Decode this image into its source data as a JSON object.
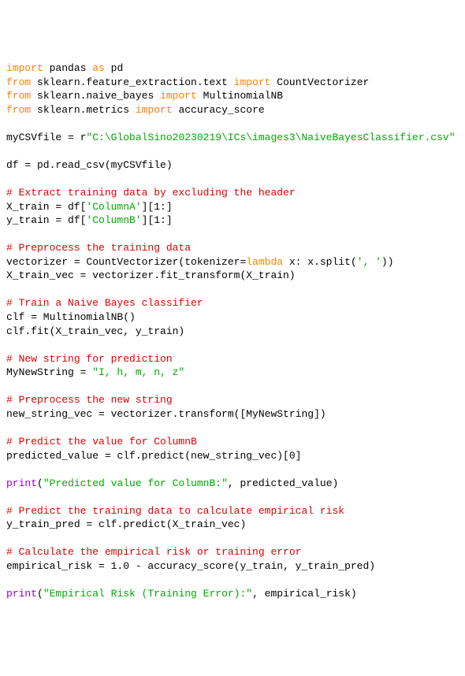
{
  "lines": [
    {
      "type": "code",
      "spans": [
        {
          "cls": "kw",
          "t": "import"
        },
        {
          "cls": "nam",
          "t": " pandas "
        },
        {
          "cls": "kw",
          "t": "as"
        },
        {
          "cls": "nam",
          "t": " pd"
        }
      ]
    },
    {
      "type": "code",
      "spans": [
        {
          "cls": "kw",
          "t": "from"
        },
        {
          "cls": "nam",
          "t": " sklearn.feature_extraction.text "
        },
        {
          "cls": "kw",
          "t": "import"
        },
        {
          "cls": "nam",
          "t": " CountVectorizer"
        }
      ]
    },
    {
      "type": "code",
      "spans": [
        {
          "cls": "kw",
          "t": "from"
        },
        {
          "cls": "nam",
          "t": " sklearn.naive_bayes "
        },
        {
          "cls": "kw",
          "t": "import"
        },
        {
          "cls": "nam",
          "t": " MultinomialNB"
        }
      ]
    },
    {
      "type": "code",
      "spans": [
        {
          "cls": "kw",
          "t": "from"
        },
        {
          "cls": "nam",
          "t": " sklearn.metrics "
        },
        {
          "cls": "kw",
          "t": "import"
        },
        {
          "cls": "nam",
          "t": " accuracy_score"
        }
      ]
    },
    {
      "type": "blank"
    },
    {
      "type": "code",
      "spans": [
        {
          "cls": "nam",
          "t": "myCSVfile = "
        },
        {
          "cls": "raw",
          "t": "r"
        },
        {
          "cls": "str",
          "t": "\"C:\\GlobalSino20230219\\ICs\\images3\\NaiveBayesClassifier.csv\""
        }
      ]
    },
    {
      "type": "blank"
    },
    {
      "type": "code",
      "spans": [
        {
          "cls": "nam",
          "t": "df = pd.read_csv(myCSVfile)"
        }
      ]
    },
    {
      "type": "blank"
    },
    {
      "type": "comment",
      "t": "# Extract training data by excluding the header"
    },
    {
      "type": "code",
      "spans": [
        {
          "cls": "nam",
          "t": "X_train = df["
        },
        {
          "cls": "str",
          "t": "'ColumnA'"
        },
        {
          "cls": "nam",
          "t": "][1:]"
        }
      ]
    },
    {
      "type": "code",
      "spans": [
        {
          "cls": "nam",
          "t": "y_train = df["
        },
        {
          "cls": "str",
          "t": "'ColumnB'"
        },
        {
          "cls": "nam",
          "t": "][1:]"
        }
      ]
    },
    {
      "type": "blank"
    },
    {
      "type": "comment",
      "t": "# Preprocess the training data"
    },
    {
      "type": "code",
      "spans": [
        {
          "cls": "nam",
          "t": "vectorizer = CountVectorizer(tokenizer="
        },
        {
          "cls": "kw",
          "t": "lambda"
        },
        {
          "cls": "nam",
          "t": " x: x.split("
        },
        {
          "cls": "str",
          "t": "', '"
        },
        {
          "cls": "nam",
          "t": "))"
        }
      ]
    },
    {
      "type": "code",
      "spans": [
        {
          "cls": "nam",
          "t": "X_train_vec = vectorizer.fit_transform(X_train)"
        }
      ]
    },
    {
      "type": "blank"
    },
    {
      "type": "comment",
      "t": "# Train a Naive Bayes classifier"
    },
    {
      "type": "code",
      "spans": [
        {
          "cls": "nam",
          "t": "clf = MultinomialNB()"
        }
      ]
    },
    {
      "type": "code",
      "spans": [
        {
          "cls": "nam",
          "t": "clf.fit(X_train_vec, y_train)"
        }
      ]
    },
    {
      "type": "blank"
    },
    {
      "type": "comment",
      "t": "# New string for prediction"
    },
    {
      "type": "code",
      "spans": [
        {
          "cls": "nam",
          "t": "MyNewString = "
        },
        {
          "cls": "str",
          "t": "\"I, h, m, n, z\""
        }
      ]
    },
    {
      "type": "blank"
    },
    {
      "type": "comment",
      "t": "# Preprocess the new string"
    },
    {
      "type": "code",
      "spans": [
        {
          "cls": "nam",
          "t": "new_string_vec = vectorizer.transform([MyNewString])"
        }
      ]
    },
    {
      "type": "blank"
    },
    {
      "type": "comment",
      "t": "# Predict the value for ColumnB"
    },
    {
      "type": "code",
      "spans": [
        {
          "cls": "nam",
          "t": "predicted_value = clf.predict(new_string_vec)[0]"
        }
      ]
    },
    {
      "type": "blank"
    },
    {
      "type": "code",
      "spans": [
        {
          "cls": "fn",
          "t": "print"
        },
        {
          "cls": "nam",
          "t": "("
        },
        {
          "cls": "str",
          "t": "\"Predicted value for ColumnB:\""
        },
        {
          "cls": "nam",
          "t": ", predicted_value)"
        }
      ]
    },
    {
      "type": "blank"
    },
    {
      "type": "comment",
      "t": "# Predict the training data to calculate empirical risk"
    },
    {
      "type": "code",
      "spans": [
        {
          "cls": "nam",
          "t": "y_train_pred = clf.predict(X_train_vec)"
        }
      ]
    },
    {
      "type": "blank"
    },
    {
      "type": "comment",
      "t": "# Calculate the empirical risk or training error"
    },
    {
      "type": "code",
      "spans": [
        {
          "cls": "nam",
          "t": "empirical_risk = 1.0 - accuracy_score(y_train, y_train_pred)"
        }
      ]
    },
    {
      "type": "blank"
    },
    {
      "type": "code",
      "spans": [
        {
          "cls": "fn",
          "t": "print"
        },
        {
          "cls": "nam",
          "t": "("
        },
        {
          "cls": "str",
          "t": "\"Empirical Risk (Training Error):\""
        },
        {
          "cls": "nam",
          "t": ", empirical_risk)"
        }
      ]
    }
  ]
}
